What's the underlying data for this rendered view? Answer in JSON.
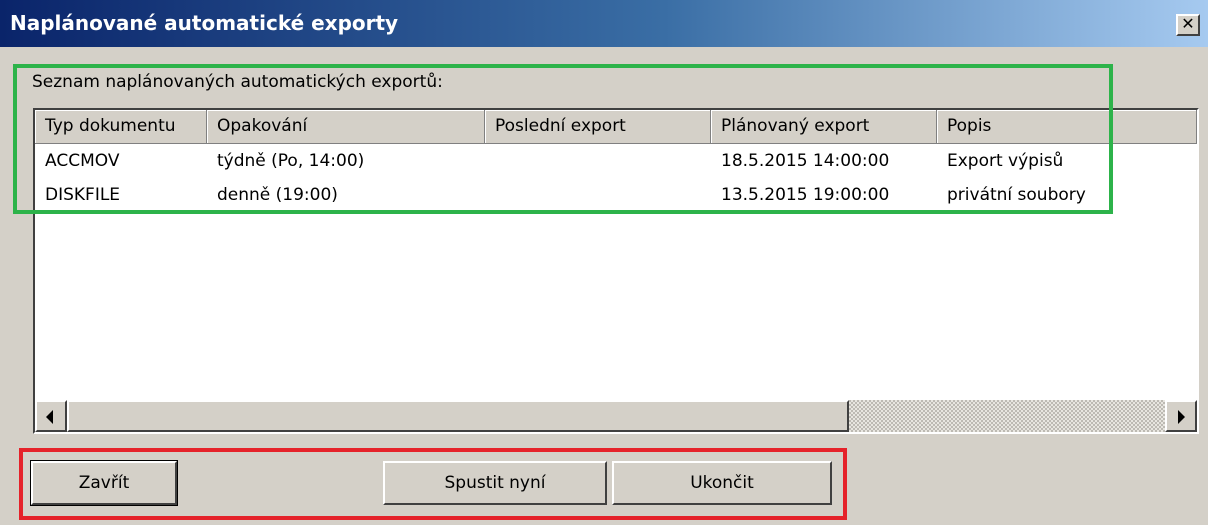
{
  "window": {
    "title": "Naplánované automatické exporty",
    "close_symbol": "✕"
  },
  "list": {
    "label": "Seznam naplánovaných automatických exportů:",
    "columns": [
      "Typ dokumentu",
      "Opakování",
      "Poslední export",
      "Plánovaný export",
      "Popis"
    ],
    "rows": [
      [
        "ACCMOV",
        "týdně (Po, 14:00)",
        "",
        "18.5.2015 14:00:00",
        "Export výpisů"
      ],
      [
        "DISKFILE",
        "denně (19:00)",
        "",
        "13.5.2015 19:00:00",
        "privátní soubory"
      ]
    ]
  },
  "buttons": {
    "close": "Zavřít",
    "run_now": "Spustit nyní",
    "stop": "Ukončit"
  },
  "annotations": {
    "list_highlight_color": "#2db34a",
    "buttons_highlight_color": "#e5222a"
  },
  "icons": [
    "close-icon",
    "arrow-left-icon",
    "arrow-right-icon"
  ]
}
